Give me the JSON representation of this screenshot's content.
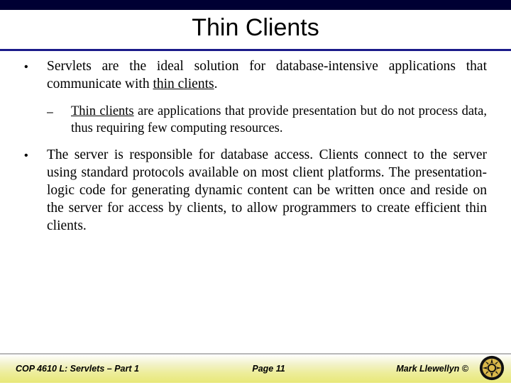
{
  "title": "Thin Clients",
  "bullets": {
    "b1_prefix": "Servlets are the ideal solution for database-intensive applications that communicate with ",
    "b1_underlined": "thin clients",
    "b1_suffix": ".",
    "sub1_underlined": "Thin clients",
    "sub1_rest": " are applications that provide presentation but do not process data, thus requiring few computing resources.",
    "b2": "The server is responsible for database access.  Clients connect to the server using standard protocols available on most client platforms.  The presentation-logic code for generating dynamic content can be written once and reside on the server for access by clients, to allow programmers to create efficient thin clients."
  },
  "footer": {
    "left": "COP 4610 L: Servlets – Part 1",
    "center": "Page 11",
    "right": "Mark Llewellyn ©"
  }
}
